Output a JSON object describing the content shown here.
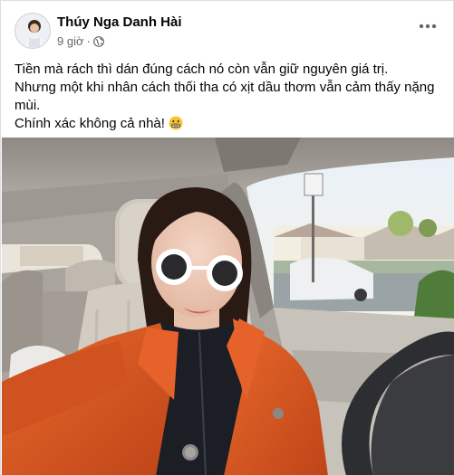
{
  "post": {
    "author": "Thúy Nga Danh Hài",
    "time": "9 giờ",
    "separator": "·",
    "privacy_icon": "globe-icon",
    "more_icon": "more-options-icon",
    "lines": [
      "Tiền mà rách thì dán đúng cách nó còn vẫn giữ nguyên giá trị.",
      "Nhưng một khi nhân cách thối tha có xịt dầu thơm vẫn cảm thấy nặng mùi.",
      "Chính xác không cả nhà!"
    ],
    "emoji": "grimacing-face-emoji"
  },
  "colors": {
    "secondary_text": "#65676b",
    "jacket": "#d8511f",
    "car_interior": "#b9b4ad"
  }
}
